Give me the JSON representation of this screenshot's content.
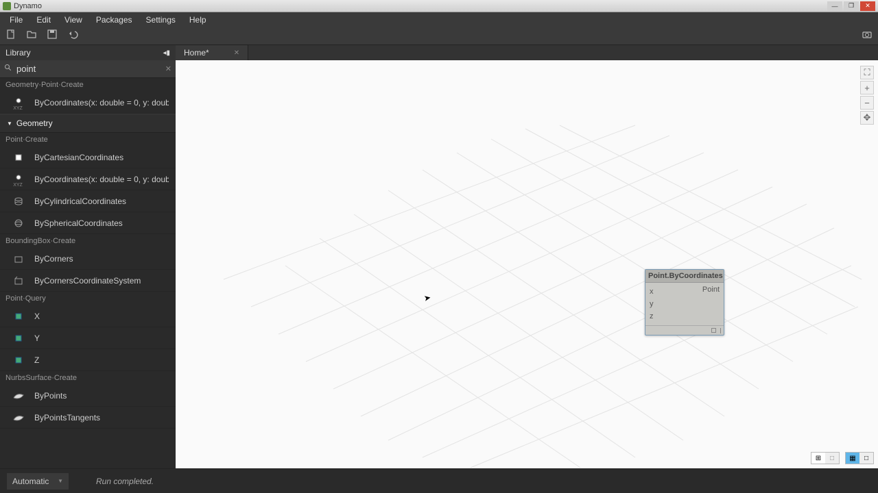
{
  "title": "Dynamo",
  "menu": [
    "File",
    "Edit",
    "View",
    "Packages",
    "Settings",
    "Help"
  ],
  "library": {
    "title": "Library",
    "search_value": "point",
    "sections": {
      "top_sub": "Geometry·Point·Create",
      "top_item": "ByCoordinates(x: double = 0, y: double",
      "category": "Geometry",
      "point_create": "Point·Create",
      "items_pc": [
        "ByCartesianCoordinates",
        "ByCoordinates(x: double = 0, y: double",
        "ByCylindricalCoordinates",
        "BySphericalCoordinates"
      ],
      "bb_create": "BoundingBox·Create",
      "items_bb": [
        "ByCorners",
        "ByCornersCoordinateSystem"
      ],
      "point_query": "Point·Query",
      "items_pq": [
        "X",
        "Y",
        "Z"
      ],
      "nurbs_create": "NurbsSurface·Create",
      "items_ns": [
        "ByPoints",
        "ByPointsTangents"
      ]
    }
  },
  "tab": {
    "label": "Home*"
  },
  "node": {
    "title": "Point.ByCoordinates",
    "inputs": [
      "x",
      "y",
      "z"
    ],
    "output": "Point"
  },
  "status": {
    "mode": "Automatic",
    "msg": "Run completed."
  },
  "icon_tiny": "XYZ"
}
